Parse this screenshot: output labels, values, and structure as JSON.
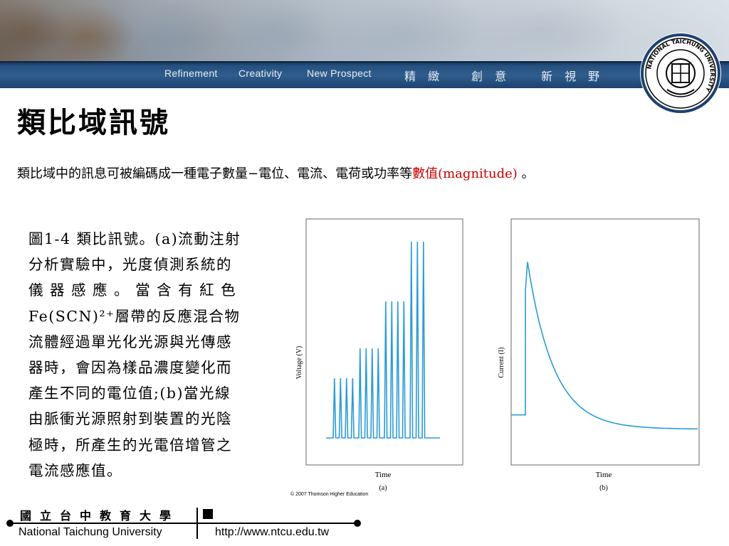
{
  "header": {
    "slogan_en": [
      "Refinement",
      "Creativity",
      "New Prospect"
    ],
    "slogan_cn": [
      "精 緻",
      "創 意",
      "新 視 野"
    ],
    "logo_text": "NATIONAL TAICHUNG UNIVERSITY",
    "logo_seal_text": "國立臺中教育大學"
  },
  "slide": {
    "title": "類比域訊號",
    "intro_text": "類比域中的訊息可被編碼成一種電子數量−電位、電流、電荷或功率等",
    "intro_accent": "數值(magnitude)",
    "intro_end": " 。",
    "caption_lines": [
      "圖1-4  類比訊號。(a)流動注射",
      "分析實驗中，光度偵測系統的",
      "儀 器 感 應 。 當 含 有 紅 色",
      "Fe(SCN)²⁺層帶的反應混合物",
      "流體經過單光化光源與光傳感",
      "器時，會因為樣品濃度變化而",
      "產生不同的電位值;(b)當光線",
      "由脈衝光源照射到裝置的光陰",
      "極時，所產生的光電倍增管之",
      "電流感應值。"
    ]
  },
  "figure": {
    "panel_a": {
      "xlabel": "Time",
      "ylabel": "Voltage (V)",
      "label": "(a)"
    },
    "panel_b": {
      "xlabel": "Time",
      "ylabel": "Current (I)",
      "label": "(b)"
    },
    "copyright": "© 2007 Thomson Higher Education",
    "line_color": "#2b9bd6"
  },
  "chart_data": [
    {
      "type": "line",
      "title": "",
      "xlabel": "Time",
      "ylabel": "Voltage (V)",
      "description_label": "(a)",
      "peak_groups": [
        {
          "count": 4,
          "height": 0.28
        },
        {
          "count": 4,
          "height": 0.42
        },
        {
          "count": 4,
          "height": 0.64
        },
        {
          "count": 3,
          "height": 0.92
        }
      ]
    },
    {
      "type": "line",
      "title": "",
      "xlabel": "Time",
      "ylabel": "Current (I)",
      "description_label": "(b)",
      "baseline": 0.18,
      "peak": 0.82,
      "final": 0.12
    }
  ],
  "footer": {
    "university_cn": "國立台中教育大學",
    "university_en": "National Taichung University",
    "url": "http://www.ntcu.edu.tw"
  }
}
